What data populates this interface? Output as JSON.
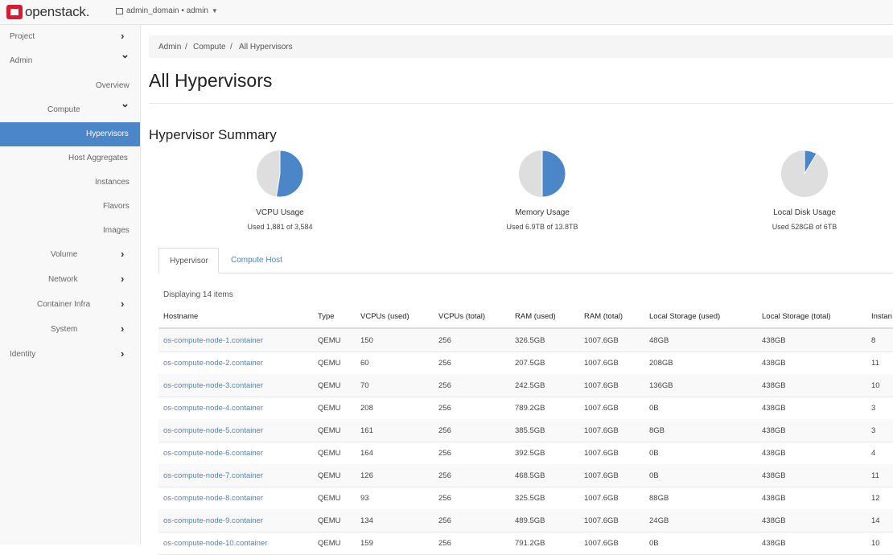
{
  "brand": {
    "name": "openstack.",
    "color": "#da1a32"
  },
  "project_picker": {
    "label": "admin_domain • admin"
  },
  "sidebar": {
    "accent": "#4a86c8",
    "items": [
      {
        "label": "Project"
      },
      {
        "label": "Admin"
      },
      {
        "label": "Overview"
      },
      {
        "label": "Compute"
      },
      {
        "label": "Hypervisors"
      },
      {
        "label": "Host Aggregates"
      },
      {
        "label": "Instances"
      },
      {
        "label": "Flavors"
      },
      {
        "label": "Images"
      },
      {
        "label": "Volume"
      },
      {
        "label": "Network"
      },
      {
        "label": "Container Infra"
      },
      {
        "label": "System"
      },
      {
        "label": "Identity"
      }
    ]
  },
  "breadcrumb": [
    "Admin",
    "/",
    "Compute",
    "/",
    "All Hypervisors"
  ],
  "page_title": "All Hypervisors",
  "summary": {
    "title": "Hypervisor Summary",
    "charts": [
      {
        "label": "VCPU Usage",
        "sub": "Used 1,881 of 3,584",
        "fraction": 0.525
      },
      {
        "label": "Memory Usage",
        "sub": "Used 6.9TB of 13.8TB",
        "fraction": 0.5
      },
      {
        "label": "Local Disk Usage",
        "sub": "Used 528GB of 6TB",
        "fraction": 0.086
      }
    ]
  },
  "tabs": [
    {
      "label": "Hypervisor"
    },
    {
      "label": "Compute Host"
    }
  ],
  "display_count": "Displaying 14 items",
  "table": {
    "headers": [
      "Hostname",
      "Type",
      "VCPUs (used)",
      "VCPUs (total)",
      "RAM (used)",
      "RAM (total)",
      "Local Storage (used)",
      "Local Storage (total)",
      "Instan"
    ],
    "rows": [
      [
        "os-compute-node-1.container",
        "QEMU",
        "150",
        "256",
        "326.5GB",
        "1007.6GB",
        "48GB",
        "438GB",
        "8"
      ],
      [
        "os-compute-node-2.container",
        "QEMU",
        "60",
        "256",
        "207.5GB",
        "1007.6GB",
        "208GB",
        "438GB",
        "11"
      ],
      [
        "os-compute-node-3.container",
        "QEMU",
        "70",
        "256",
        "242.5GB",
        "1007.6GB",
        "136GB",
        "438GB",
        "10"
      ],
      [
        "os-compute-node-4.container",
        "QEMU",
        "208",
        "256",
        "789.2GB",
        "1007.6GB",
        "0B",
        "438GB",
        "3"
      ],
      [
        "os-compute-node-5.container",
        "QEMU",
        "161",
        "256",
        "385.5GB",
        "1007.6GB",
        "8GB",
        "438GB",
        "3"
      ],
      [
        "os-compute-node-6.container",
        "QEMU",
        "164",
        "256",
        "392.5GB",
        "1007.6GB",
        "0B",
        "438GB",
        "4"
      ],
      [
        "os-compute-node-7.container",
        "QEMU",
        "126",
        "256",
        "468.5GB",
        "1007.6GB",
        "0B",
        "438GB",
        "11"
      ],
      [
        "os-compute-node-8.container",
        "QEMU",
        "93",
        "256",
        "325.5GB",
        "1007.6GB",
        "88GB",
        "438GB",
        "12"
      ],
      [
        "os-compute-node-9.container",
        "QEMU",
        "134",
        "256",
        "489.5GB",
        "1007.6GB",
        "24GB",
        "438GB",
        "14"
      ],
      [
        "os-compute-node-10.container",
        "QEMU",
        "159",
        "256",
        "791.2GB",
        "1007.6GB",
        "0B",
        "438GB",
        "10"
      ]
    ]
  }
}
